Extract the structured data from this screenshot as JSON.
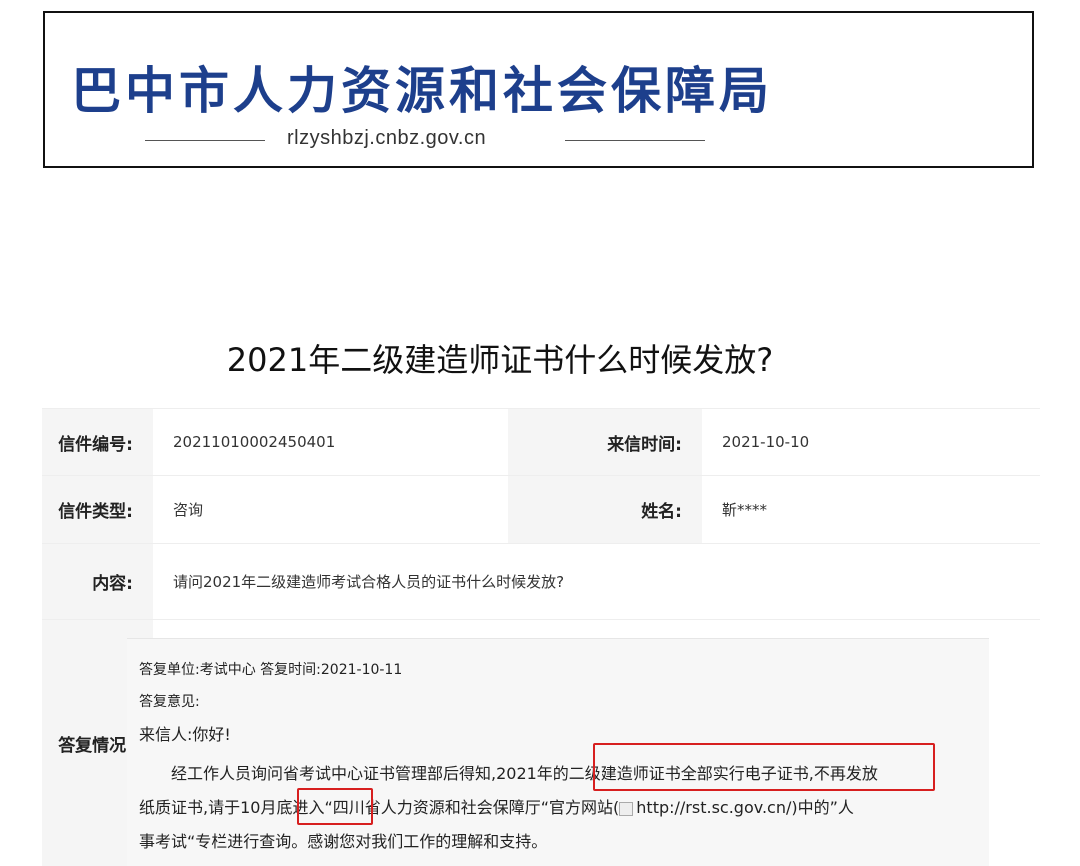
{
  "banner": {
    "title": "巴中市人力资源和社会保障局",
    "url": "rlzyshbzj.cnbz.gov.cn",
    "title_color": "#1d3f8c"
  },
  "page_title": "2021年二级建造师证书什么时候发放?",
  "letter": {
    "number_label": "信件编号:",
    "number_value": "20211010002450401",
    "time_label": "来信时间:",
    "time_value": "2021-10-10",
    "type_label": "信件类型:",
    "type_value": "咨询",
    "name_label": "姓名:",
    "name_value": "靳****",
    "content_label": "内容:",
    "content_value": "请问2021年二级建造师考试合格人员的证书什么时候发放?",
    "reply_label": "答复情况:"
  },
  "reply": {
    "unit_line": "答复单位:考试中心    答复时间:2021-10-11",
    "opinion_label": "答复意见:",
    "greeting": "来信人:你好!",
    "para_line1": "经工作人员询问省考试中心证书管理部后得知,2021年的二级建造师证书全部实行电子证书,不再发放",
    "para_line2_pre": "纸质证书,请于10月底进入“四川省人力资源和社会保障厅“官方网站(",
    "link": "http://rst.sc.gov.cn/",
    "para_line2_post": ")中的”人",
    "para_line3": "事考试“专栏进行查询。感谢您对我们工作的理解和支持。",
    "highlight_color": "#d71f1f"
  }
}
